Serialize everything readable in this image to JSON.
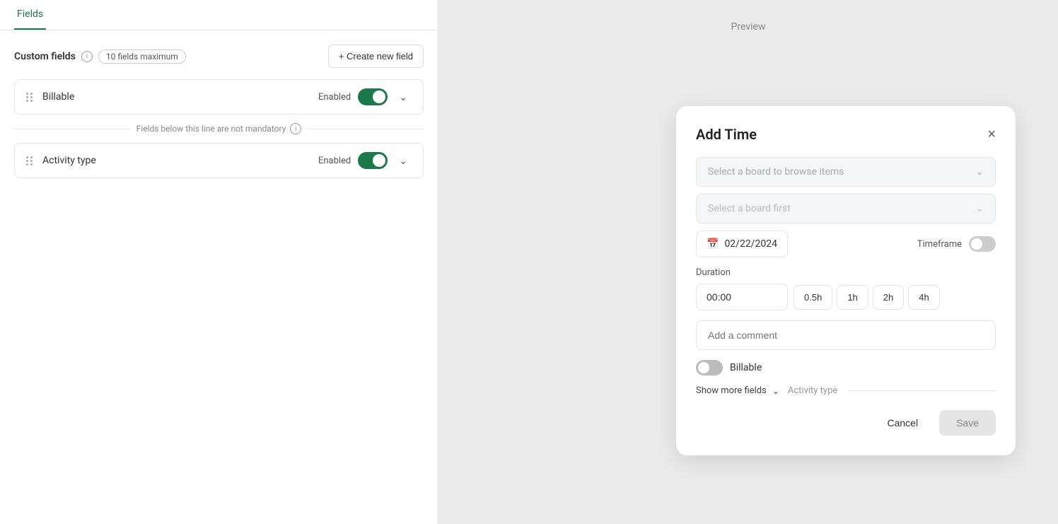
{
  "tab": {
    "label": "Fields"
  },
  "customFields": {
    "title": "Custom fields",
    "maxBadge": "10 fields maximum",
    "createBtn": "+ Create new field",
    "separatorText": "Fields below this line are not mandatory",
    "fields": [
      {
        "name": "Billable",
        "status": "Enabled",
        "enabled": true
      },
      {
        "name": "Activity type",
        "status": "Enabled",
        "enabled": true
      }
    ]
  },
  "preview": {
    "label": "Preview"
  },
  "modal": {
    "title": "Add Time",
    "closeIcon": "×",
    "selectBoardPlaceholder": "Select a board to browse items",
    "selectBoardFirstPlaceholder": "Select a board first",
    "date": "02/22/2024",
    "timeframeLabel": "Timeframe",
    "durationLabel": "Duration",
    "durationValue": "00:00",
    "quickBtns": [
      "0.5h",
      "1h",
      "2h",
      "4h"
    ],
    "commentPlaceholder": "Add a comment",
    "billableLabel": "Billable",
    "showMoreLabel": "Show more fields",
    "activityTypeLabel": "Activity type",
    "cancelBtn": "Cancel",
    "saveBtn": "Save"
  }
}
